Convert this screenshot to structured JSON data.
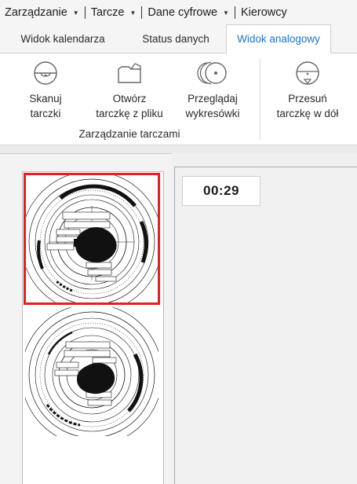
{
  "menu": {
    "items": [
      {
        "label": "Zarządzanie"
      },
      {
        "label": "Tarcze"
      },
      {
        "label": "Dane cyfrowe"
      },
      {
        "label": "Kierowcy"
      }
    ]
  },
  "tabs": [
    {
      "label": "Widok kalendarza"
    },
    {
      "label": "Status danych"
    },
    {
      "label": "Widok analogowy",
      "active": true
    }
  ],
  "ribbon": {
    "buttons": {
      "scan": {
        "line1": "Skanuj",
        "line2": "tarczki",
        "icon": "scan-disc-icon"
      },
      "open": {
        "line1": "Otwórz",
        "line2": "tarczkę z pliku",
        "icon": "open-folder-icon"
      },
      "browse": {
        "line1": "Przeglądaj",
        "line2": "wykresówki",
        "icon": "disc-stack-icon"
      },
      "move_down": {
        "line1": "Przesuń",
        "line2": "tarczkę w dół",
        "icon": "move-disc-down-icon"
      }
    },
    "group_label": "Zarządzanie tarczami"
  },
  "viewer": {
    "time": "00:29"
  },
  "colors": {
    "accent": "#1f73c5",
    "selection": "#e81d1d"
  }
}
